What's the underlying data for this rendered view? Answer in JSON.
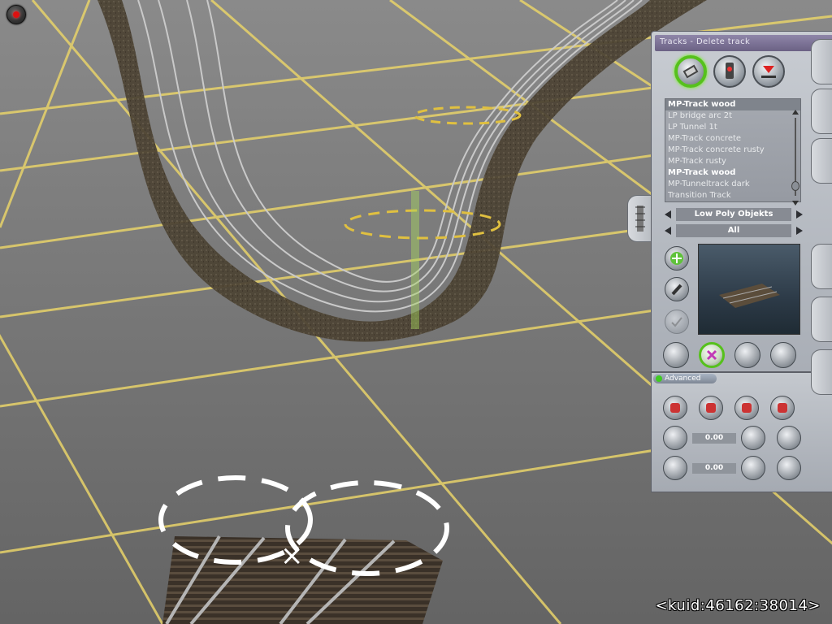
{
  "panel": {
    "title": "Tracks - Delete track",
    "mode_buttons": [
      {
        "name": "track-mode-icon",
        "active": true
      },
      {
        "name": "trackmark-mode-icon",
        "active": false
      },
      {
        "name": "trigger-mode-icon",
        "active": false
      }
    ],
    "track_list": {
      "items": [
        {
          "label": "MP-Track wood",
          "state": "selected"
        },
        {
          "label": "LP bridge arc 2t",
          "state": "normal"
        },
        {
          "label": "LP Tunnel 1t",
          "state": "normal"
        },
        {
          "label": "MP-Track concrete",
          "state": "normal"
        },
        {
          "label": "MP-Track concrete rusty",
          "state": "normal"
        },
        {
          "label": "MP-Track rusty",
          "state": "normal"
        },
        {
          "label": "MP-Track wood",
          "state": "strong"
        },
        {
          "label": "MP-Tunneltrack dark",
          "state": "normal"
        },
        {
          "label": "Transition Track",
          "state": "normal"
        }
      ]
    },
    "category_filter": "Low Poly Objekts",
    "region_filter": "All",
    "advanced_label": "Advanced",
    "advanced_values": {
      "height": "0.00",
      "grade": "0.00"
    }
  },
  "kuid": "<kuid:46162:38014>",
  "colors": {
    "grid": "#e8d36a",
    "ground": "#6e6e6e",
    "panel": "#b8bcc2",
    "accent_green": "#56c11c"
  }
}
